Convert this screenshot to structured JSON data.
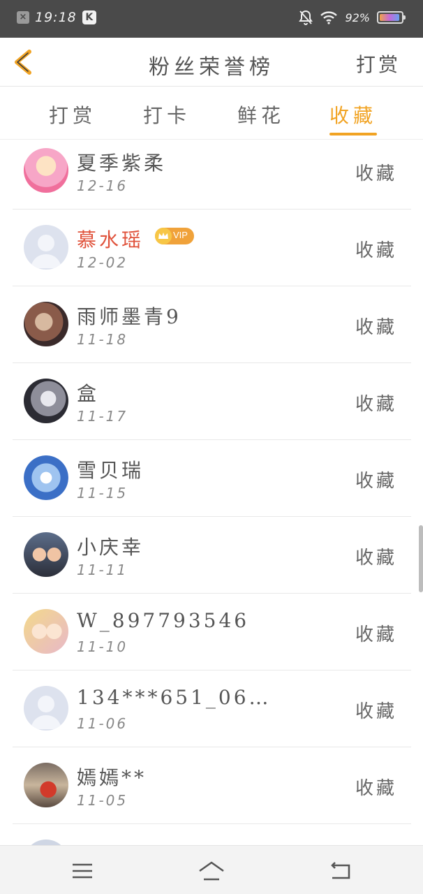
{
  "status_bar": {
    "time": "19:18",
    "battery": "92%"
  },
  "header": {
    "title": "粉丝荣誉榜",
    "right_action": "打赏"
  },
  "tabs": [
    {
      "label": "打赏",
      "active": false
    },
    {
      "label": "打卡",
      "active": false
    },
    {
      "label": "鲜花",
      "active": false
    },
    {
      "label": "收藏",
      "active": true
    }
  ],
  "accent_color": "#f1a323",
  "vip_name_color": "#e0533c",
  "rows": [
    {
      "name": "夏季紫柔",
      "date": "12-16",
      "action": "收藏",
      "avatar": "anime-girl-avatar",
      "vip": false
    },
    {
      "name": "慕水瑶",
      "date": "12-02",
      "action": "收藏",
      "avatar": "default-avatar",
      "vip": true,
      "vip_label": "VIP"
    },
    {
      "name": "雨师墨青9",
      "date": "11-18",
      "action": "收藏",
      "avatar": "anime-avatar",
      "vip": false
    },
    {
      "name": "盒",
      "date": "11-17",
      "action": "收藏",
      "avatar": "anime-boy-avatar",
      "vip": false
    },
    {
      "name": "雪贝瑞",
      "date": "11-15",
      "action": "收藏",
      "avatar": "blue-heart-avatar",
      "vip": false
    },
    {
      "name": "小庆幸",
      "date": "11-11",
      "action": "收藏",
      "avatar": "photo-avatar",
      "vip": false
    },
    {
      "name": "W_897793546",
      "date": "11-10",
      "action": "收藏",
      "avatar": "anime-girl-avatar",
      "vip": false
    },
    {
      "name": "134***651_06…",
      "date": "11-06",
      "action": "收藏",
      "avatar": "default-avatar",
      "vip": false
    },
    {
      "name": "嫣嫣**",
      "date": "11-05",
      "action": "收藏",
      "avatar": "photo-avatar",
      "vip": false
    }
  ]
}
